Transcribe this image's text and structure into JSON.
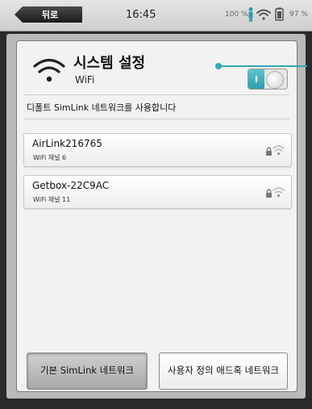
{
  "status": {
    "back_label": "뒤로",
    "time": "16:45",
    "battery_left": "100 %",
    "battery_right": "97 %"
  },
  "header": {
    "title": "시스템 설정",
    "subtitle": "WiFi",
    "toggle_label": "I"
  },
  "callout_text": "디폴트 SimLink 네트워크를 사용합니다",
  "networks": [
    {
      "name": "AirLink216765",
      "channel": "WiFi 채널 6"
    },
    {
      "name": "Getbox-22C9AC",
      "channel": "WiFi 채널 11"
    }
  ],
  "buttons": {
    "default_label": "기본 SimLink 네트워크",
    "custom_label": "사용자 정의 애드혹 네트워크"
  },
  "colors": {
    "accent": "#30aab8",
    "panel": "#f2f2f2"
  }
}
